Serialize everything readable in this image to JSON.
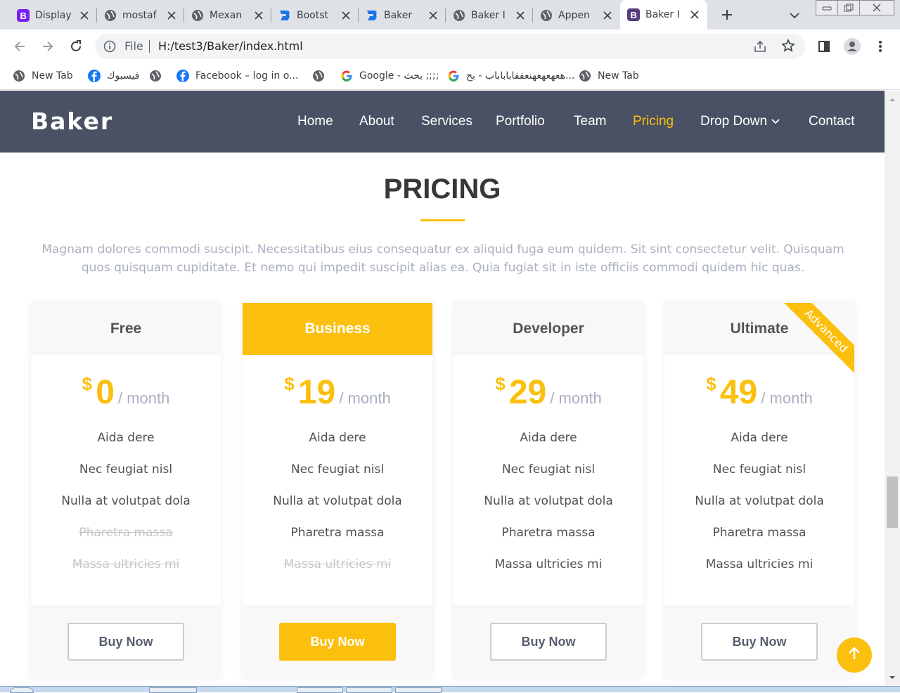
{
  "browser": {
    "tabs": [
      {
        "title": "Display",
        "favicon": "bootstrap-icon"
      },
      {
        "title": "mostaf",
        "favicon": "globe-icon"
      },
      {
        "title": "Mexan",
        "favicon": "globe-icon"
      },
      {
        "title": "Bootst",
        "favicon": "bootstrapmade-icon"
      },
      {
        "title": "Baker",
        "favicon": "bootstrapmade-icon"
      },
      {
        "title": "Baker I",
        "favicon": "globe-icon"
      },
      {
        "title": "Appen",
        "favicon": "globe-icon"
      },
      {
        "title": "Baker I",
        "favicon": "bootstrap-icon",
        "active": true
      }
    ],
    "address": {
      "scheme_label": "File",
      "url": "H:/test3/Baker/index.html"
    },
    "bookmarks": [
      {
        "label": "New Tab",
        "icon": "globe-icon"
      },
      {
        "label": "فيسبوك",
        "icon": "facebook-icon"
      },
      {
        "label": "",
        "icon": "globe-icon"
      },
      {
        "label": "Facebook – log in o...",
        "icon": "facebook-icon"
      },
      {
        "label": "",
        "icon": "globe-icon"
      },
      {
        "label": "Google - بحث ;;;;",
        "icon": "google-icon"
      },
      {
        "label": "هعهعهعهنعففاباباباب - بح...",
        "icon": "google-icon"
      },
      {
        "label": "New Tab",
        "icon": "globe-icon"
      }
    ]
  },
  "site": {
    "logo": "Baker",
    "nav": [
      "Home",
      "About",
      "Services",
      "Portfolio",
      "Team",
      "Pricing",
      "Drop Down",
      "Contact"
    ],
    "active_nav": "Pricing",
    "section_title": "PRICING",
    "section_desc": "Magnam dolores commodi suscipit. Necessitatibus eius consequatur ex aliquid fuga eum quidem. Sit sint consectetur velit. Quisquam quos quisquam cupiditate. Et nemo qui impedit suscipit alias ea. Quia fugiat sit in iste officiis commodi quidem hic quas.",
    "plans": [
      {
        "name": "Free",
        "currency": "$",
        "amount": "0",
        "period": "/ month",
        "features": [
          "Aida dere",
          "Nec feugiat nisl",
          "Nulla at volutpat dola",
          "Pharetra massa",
          "Massa ultricies mi"
        ],
        "unavailable": [
          false,
          false,
          false,
          true,
          true
        ],
        "button": "Buy Now"
      },
      {
        "name": "Business",
        "currency": "$",
        "amount": "19",
        "period": "/ month",
        "features": [
          "Aida dere",
          "Nec feugiat nisl",
          "Nulla at volutpat dola",
          "Pharetra massa",
          "Massa ultricies mi"
        ],
        "unavailable": [
          false,
          false,
          false,
          false,
          true
        ],
        "button": "Buy Now",
        "featured": true
      },
      {
        "name": "Developer",
        "currency": "$",
        "amount": "29",
        "period": "/ month",
        "features": [
          "Aida dere",
          "Nec feugiat nisl",
          "Nulla at volutpat dola",
          "Pharetra massa",
          "Massa ultricies mi"
        ],
        "unavailable": [
          false,
          false,
          false,
          false,
          false
        ],
        "button": "Buy Now"
      },
      {
        "name": "Ultimate",
        "currency": "$",
        "amount": "49",
        "period": "/ month",
        "features": [
          "Aida dere",
          "Nec feugiat nisl",
          "Nulla at volutpat dola",
          "Pharetra massa",
          "Massa ultricies mi"
        ],
        "unavailable": [
          false,
          false,
          false,
          false,
          false
        ],
        "button": "Buy Now",
        "ribbon": "Advanced"
      }
    ]
  },
  "colors": {
    "accent": "#fbbf0e",
    "header_bg": "#4a5164",
    "muted_text": "#a9afbf"
  }
}
